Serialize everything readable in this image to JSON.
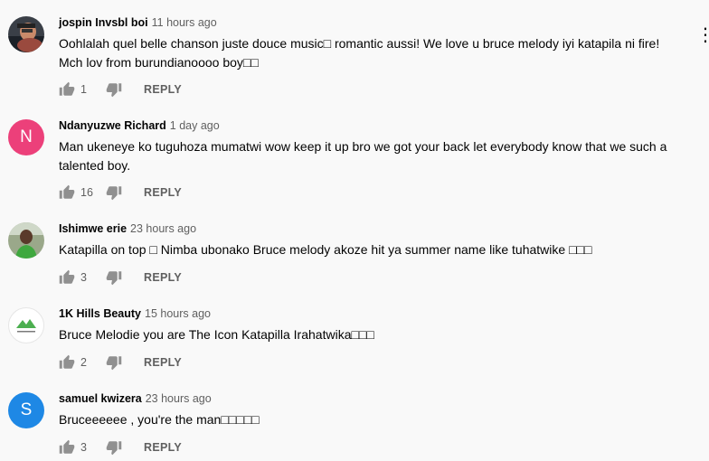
{
  "comments": [
    {
      "author": "jospin Invsbl boi",
      "time": "11 hours ago",
      "text_line1": "Oohlalah quel belle chanson juste douce music□ romantic aussi! We love u bruce melody iyi katapila ni fire!",
      "text_line2": "Mch lov from burundianoooo boy□□",
      "likes": "1",
      "reply": "REPLY",
      "avatar": "photo"
    },
    {
      "author": "Ndanyuzwe Richard",
      "time": "1 day ago",
      "text_line1": "Man ukeneye ko tuguhoza mumatwi wow keep it up bro we got your back let everybody know that we such a",
      "text_line2": "talented boy.",
      "likes": "16",
      "reply": "REPLY",
      "avatar_letter": "N",
      "avatar_color": "#ec407a"
    },
    {
      "author": "Ishimwe erie",
      "time": "23 hours ago",
      "text_line1": "Katapilla on top □ Nimba ubonako Bruce melody akoze hit ya summer name like tuhatwike □□□",
      "likes": "3",
      "reply": "REPLY",
      "avatar": "photo"
    },
    {
      "author": "1K Hills Beauty",
      "time": "15 hours ago",
      "text_line1": "Bruce Melodie you are The Icon Katapilla Irahatwika□□□",
      "likes": "2",
      "reply": "REPLY",
      "avatar": "logo"
    },
    {
      "author": "samuel kwizera",
      "time": "23 hours ago",
      "text_line1": "Bruceeeeee , you're the man□□□□□",
      "likes": "3",
      "reply": "REPLY",
      "avatar_letter": "S",
      "avatar_color": "#1e88e5"
    }
  ],
  "overflow_glyph": "⋮",
  "icons": {
    "like": "thumbs-up-icon",
    "dislike": "thumbs-down-icon",
    "menu": "more-vert-icon"
  }
}
